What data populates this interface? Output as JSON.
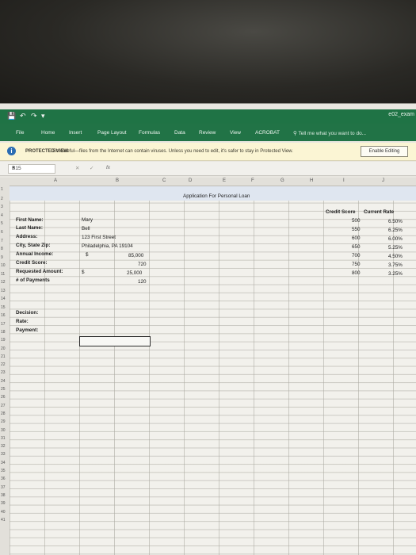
{
  "titlebar": {
    "file_name": "e02_exam",
    "quick_access": [
      "save-icon",
      "undo-icon",
      "redo-icon",
      "customize-icon"
    ]
  },
  "ribbon": {
    "tabs": [
      "File",
      "Home",
      "Insert",
      "Page Layout",
      "Formulas",
      "Data",
      "Review",
      "View",
      "ACROBAT"
    ],
    "tell_me": "Tell me what you want to do..."
  },
  "protected_view": {
    "title": "PROTECTED VIEW",
    "message": "Be careful—files from the Internet can contain viruses. Unless you need to edit, it's safer to stay in Protected View.",
    "button": "Enable Editing"
  },
  "formula_bar": {
    "name_box": "B15",
    "fx": "fx"
  },
  "columns": [
    "A",
    "B",
    "C",
    "D",
    "E",
    "F",
    "G",
    "H",
    "I",
    "J"
  ],
  "rows": [
    "1",
    "2",
    "3",
    "4",
    "5",
    "6",
    "7",
    "8",
    "9",
    "10",
    "11",
    "12",
    "13",
    "14",
    "15",
    "16",
    "17",
    "18",
    "19",
    "20",
    "21",
    "22",
    "23",
    "24",
    "25",
    "26",
    "27",
    "28",
    "29",
    "30",
    "31",
    "32",
    "33",
    "34",
    "35",
    "36",
    "37",
    "38",
    "39",
    "40",
    "41"
  ],
  "sheet": {
    "title": "Application For Personal Loan",
    "labels": {
      "first_name": "First Name:",
      "last_name": "Last Name:",
      "address": "Address:",
      "city": "City, State Zip:",
      "income": "Annual Income:",
      "credit": "Credit Score:",
      "requested": "Requested Amount:",
      "payments": "# of Payments",
      "decision": "Decision:",
      "rate": "Rate:",
      "payment": "Payment:"
    },
    "values": {
      "first_name": "Mary",
      "last_name": "Bell",
      "address": "123 First Street",
      "city": "Philadelphia, PA 19104",
      "income_symbol": "$",
      "income": "85,000",
      "credit": "720",
      "requested_symbol": "$",
      "requested": "25,000",
      "payments": "120"
    },
    "rate_table": {
      "headers": [
        "Credit Score",
        "Current Rate"
      ],
      "rows": [
        [
          "500",
          "6.50%"
        ],
        [
          "550",
          "6.25%"
        ],
        [
          "600",
          "6.00%"
        ],
        [
          "650",
          "5.25%"
        ],
        [
          "700",
          "4.50%"
        ],
        [
          "750",
          "3.75%"
        ],
        [
          "800",
          "3.25%"
        ]
      ]
    }
  }
}
